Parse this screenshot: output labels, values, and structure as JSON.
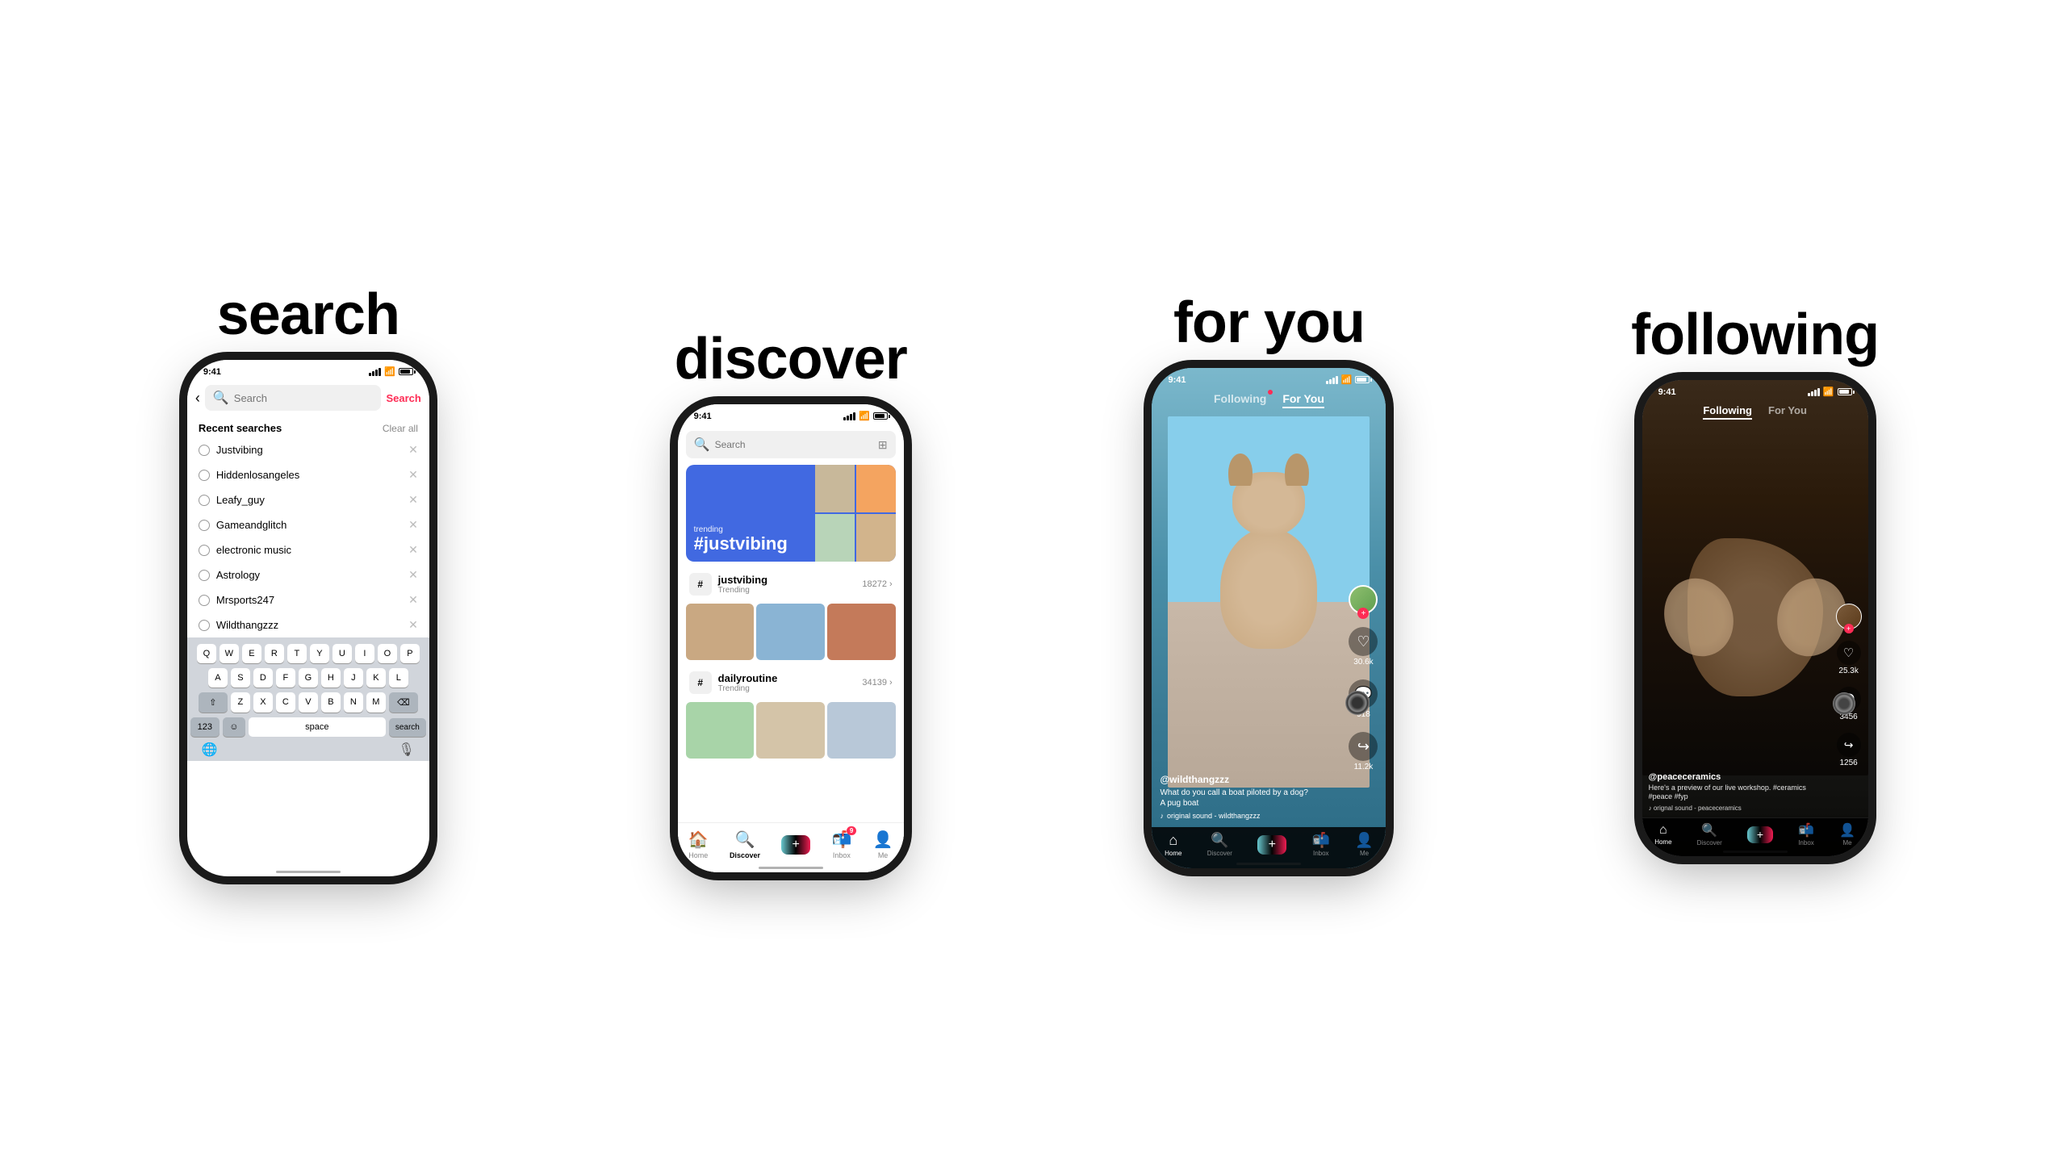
{
  "sections": {
    "search": {
      "title": "search",
      "status_time": "9:41",
      "search_placeholder": "Search",
      "search_btn": "Search",
      "recent_label": "Recent searches",
      "clear_all": "Clear all",
      "recent_items": [
        "Justvibing",
        "Hiddenlosangeles",
        "Leafy_guy",
        "Gameandglitch",
        "electronic music",
        "Astrology",
        "Mrsports247",
        "Wildthangzzz"
      ],
      "keyboard_rows": [
        [
          "Q",
          "W",
          "E",
          "R",
          "T",
          "Y",
          "U",
          "I",
          "O",
          "P"
        ],
        [
          "A",
          "S",
          "D",
          "F",
          "G",
          "H",
          "J",
          "K",
          "L"
        ],
        [
          "Z",
          "X",
          "C",
          "V",
          "B",
          "N",
          "M"
        ]
      ],
      "space_label": "space",
      "search_key": "search",
      "num_key": "123"
    },
    "discover": {
      "title": "discover",
      "status_time": "9:41",
      "search_placeholder": "Search",
      "trending_label": "trending",
      "trending_hashtag": "#justvibing",
      "trends": [
        {
          "name": "justvibing",
          "label": "Trending",
          "count": "18272"
        },
        {
          "name": "dailyroutine",
          "label": "Trending",
          "count": "34139"
        }
      ],
      "nav": {
        "home": "Home",
        "discover": "Discover",
        "inbox": "Inbox",
        "inbox_badge": "9",
        "me": "Me"
      }
    },
    "foryou": {
      "title": "for you",
      "status_time": "9:41",
      "tabs": {
        "following": "Following",
        "foryou": "For You"
      },
      "username": "@wildthangzzz",
      "caption_line1": "What do you call a boat piloted by a dog?",
      "caption_line2": "A pug boat",
      "music": "original sound - wildthangzzz",
      "likes": "30.6k",
      "comments": "918",
      "shares": "11.2k",
      "nav": {
        "home": "Home",
        "discover": "Discover",
        "inbox": "Inbox",
        "me": "Me"
      }
    },
    "following": {
      "title": "following",
      "status_time": "9:41",
      "tabs": {
        "following": "Following",
        "foryou": "For You"
      },
      "username": "@peaceceramics",
      "caption": "Here's a preview of our live workshop. #ceramics #peace #fyp",
      "music": "orignal sound - peaceceramics",
      "likes": "25.3k",
      "comments": "3456",
      "shares": "1256",
      "nav": {
        "home": "Home",
        "discover": "Discover",
        "inbox": "Inbox",
        "me": "Me"
      }
    }
  }
}
